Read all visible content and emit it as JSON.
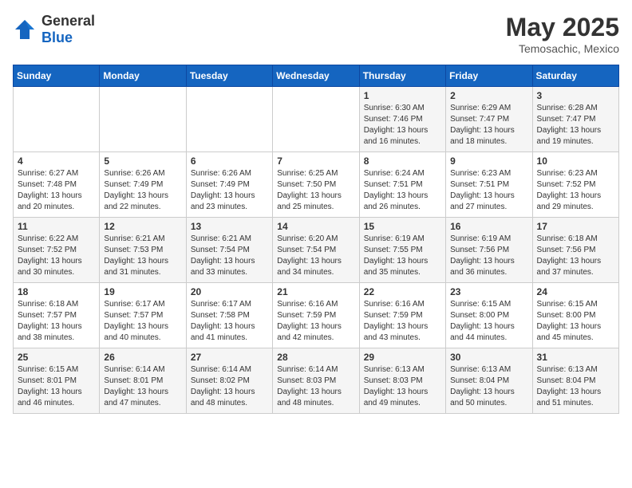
{
  "header": {
    "logo_general": "General",
    "logo_blue": "Blue",
    "title": "May 2025",
    "subtitle": "Temosachic, Mexico"
  },
  "days_of_week": [
    "Sunday",
    "Monday",
    "Tuesday",
    "Wednesday",
    "Thursday",
    "Friday",
    "Saturday"
  ],
  "weeks": [
    [
      {
        "day": "",
        "info": ""
      },
      {
        "day": "",
        "info": ""
      },
      {
        "day": "",
        "info": ""
      },
      {
        "day": "",
        "info": ""
      },
      {
        "day": "1",
        "info": "Sunrise: 6:30 AM\nSunset: 7:46 PM\nDaylight: 13 hours\nand 16 minutes."
      },
      {
        "day": "2",
        "info": "Sunrise: 6:29 AM\nSunset: 7:47 PM\nDaylight: 13 hours\nand 18 minutes."
      },
      {
        "day": "3",
        "info": "Sunrise: 6:28 AM\nSunset: 7:47 PM\nDaylight: 13 hours\nand 19 minutes."
      }
    ],
    [
      {
        "day": "4",
        "info": "Sunrise: 6:27 AM\nSunset: 7:48 PM\nDaylight: 13 hours\nand 20 minutes."
      },
      {
        "day": "5",
        "info": "Sunrise: 6:26 AM\nSunset: 7:49 PM\nDaylight: 13 hours\nand 22 minutes."
      },
      {
        "day": "6",
        "info": "Sunrise: 6:26 AM\nSunset: 7:49 PM\nDaylight: 13 hours\nand 23 minutes."
      },
      {
        "day": "7",
        "info": "Sunrise: 6:25 AM\nSunset: 7:50 PM\nDaylight: 13 hours\nand 25 minutes."
      },
      {
        "day": "8",
        "info": "Sunrise: 6:24 AM\nSunset: 7:51 PM\nDaylight: 13 hours\nand 26 minutes."
      },
      {
        "day": "9",
        "info": "Sunrise: 6:23 AM\nSunset: 7:51 PM\nDaylight: 13 hours\nand 27 minutes."
      },
      {
        "day": "10",
        "info": "Sunrise: 6:23 AM\nSunset: 7:52 PM\nDaylight: 13 hours\nand 29 minutes."
      }
    ],
    [
      {
        "day": "11",
        "info": "Sunrise: 6:22 AM\nSunset: 7:52 PM\nDaylight: 13 hours\nand 30 minutes."
      },
      {
        "day": "12",
        "info": "Sunrise: 6:21 AM\nSunset: 7:53 PM\nDaylight: 13 hours\nand 31 minutes."
      },
      {
        "day": "13",
        "info": "Sunrise: 6:21 AM\nSunset: 7:54 PM\nDaylight: 13 hours\nand 33 minutes."
      },
      {
        "day": "14",
        "info": "Sunrise: 6:20 AM\nSunset: 7:54 PM\nDaylight: 13 hours\nand 34 minutes."
      },
      {
        "day": "15",
        "info": "Sunrise: 6:19 AM\nSunset: 7:55 PM\nDaylight: 13 hours\nand 35 minutes."
      },
      {
        "day": "16",
        "info": "Sunrise: 6:19 AM\nSunset: 7:56 PM\nDaylight: 13 hours\nand 36 minutes."
      },
      {
        "day": "17",
        "info": "Sunrise: 6:18 AM\nSunset: 7:56 PM\nDaylight: 13 hours\nand 37 minutes."
      }
    ],
    [
      {
        "day": "18",
        "info": "Sunrise: 6:18 AM\nSunset: 7:57 PM\nDaylight: 13 hours\nand 38 minutes."
      },
      {
        "day": "19",
        "info": "Sunrise: 6:17 AM\nSunset: 7:57 PM\nDaylight: 13 hours\nand 40 minutes."
      },
      {
        "day": "20",
        "info": "Sunrise: 6:17 AM\nSunset: 7:58 PM\nDaylight: 13 hours\nand 41 minutes."
      },
      {
        "day": "21",
        "info": "Sunrise: 6:16 AM\nSunset: 7:59 PM\nDaylight: 13 hours\nand 42 minutes."
      },
      {
        "day": "22",
        "info": "Sunrise: 6:16 AM\nSunset: 7:59 PM\nDaylight: 13 hours\nand 43 minutes."
      },
      {
        "day": "23",
        "info": "Sunrise: 6:15 AM\nSunset: 8:00 PM\nDaylight: 13 hours\nand 44 minutes."
      },
      {
        "day": "24",
        "info": "Sunrise: 6:15 AM\nSunset: 8:00 PM\nDaylight: 13 hours\nand 45 minutes."
      }
    ],
    [
      {
        "day": "25",
        "info": "Sunrise: 6:15 AM\nSunset: 8:01 PM\nDaylight: 13 hours\nand 46 minutes."
      },
      {
        "day": "26",
        "info": "Sunrise: 6:14 AM\nSunset: 8:01 PM\nDaylight: 13 hours\nand 47 minutes."
      },
      {
        "day": "27",
        "info": "Sunrise: 6:14 AM\nSunset: 8:02 PM\nDaylight: 13 hours\nand 48 minutes."
      },
      {
        "day": "28",
        "info": "Sunrise: 6:14 AM\nSunset: 8:03 PM\nDaylight: 13 hours\nand 48 minutes."
      },
      {
        "day": "29",
        "info": "Sunrise: 6:13 AM\nSunset: 8:03 PM\nDaylight: 13 hours\nand 49 minutes."
      },
      {
        "day": "30",
        "info": "Sunrise: 6:13 AM\nSunset: 8:04 PM\nDaylight: 13 hours\nand 50 minutes."
      },
      {
        "day": "31",
        "info": "Sunrise: 6:13 AM\nSunset: 8:04 PM\nDaylight: 13 hours\nand 51 minutes."
      }
    ]
  ]
}
